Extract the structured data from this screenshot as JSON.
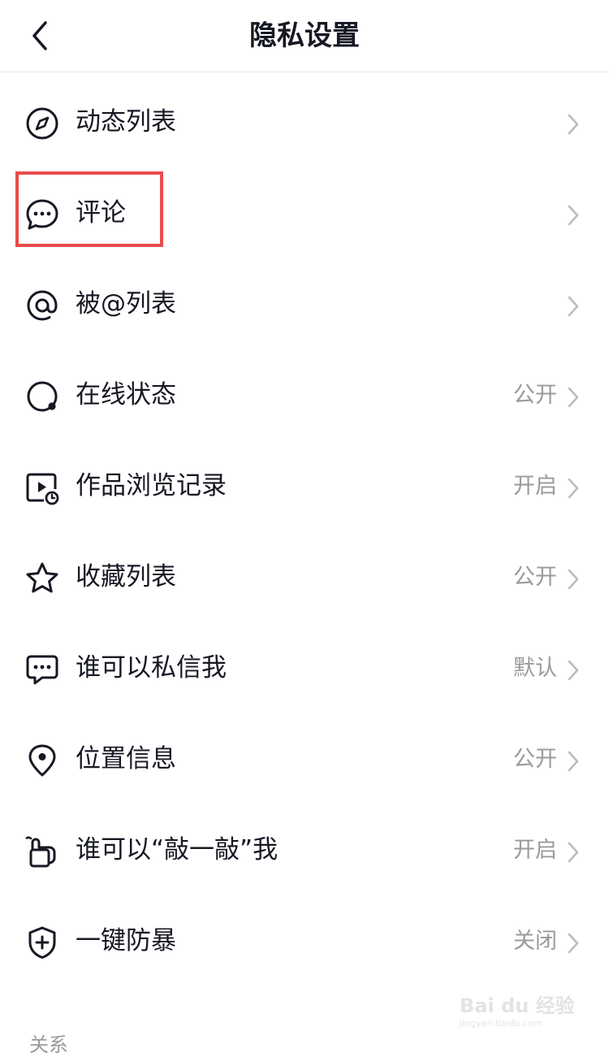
{
  "header": {
    "title": "隐私设置",
    "back_icon": "chevron-left-icon"
  },
  "rows": [
    {
      "label": "动态列表",
      "value": "",
      "icon": "compass-icon"
    },
    {
      "label": "评论",
      "value": "",
      "icon": "comment-bubble-icon"
    },
    {
      "label": "被@列表",
      "value": "",
      "icon": "at-sign-icon"
    },
    {
      "label": "在线状态",
      "value": "公开",
      "icon": "online-status-icon"
    },
    {
      "label": "作品浏览记录",
      "value": "开启",
      "icon": "video-history-icon"
    },
    {
      "label": "收藏列表",
      "value": "公开",
      "icon": "star-icon"
    },
    {
      "label": "谁可以私信我",
      "value": "默认",
      "icon": "message-icon"
    },
    {
      "label": "位置信息",
      "value": "公开",
      "icon": "location-pin-icon"
    },
    {
      "label": "谁可以“敲一敲”我",
      "value": "开启",
      "icon": "knock-hand-icon"
    },
    {
      "label": "一键防暴",
      "value": "关闭",
      "icon": "shield-plus-icon"
    }
  ],
  "section_label": "关系",
  "highlight_color": "#e94b4b",
  "watermark": {
    "brand": "Bai du 经验",
    "url": "jingyan.baidu.com"
  }
}
